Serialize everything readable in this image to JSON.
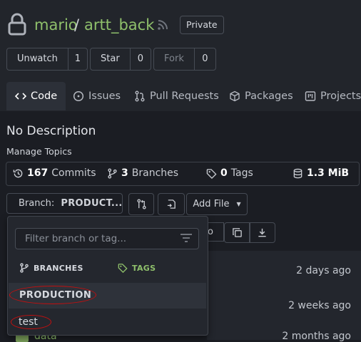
{
  "repo": {
    "owner": "mario",
    "separator": "/",
    "name": "artt_back",
    "visibility": "Private"
  },
  "actions": [
    {
      "label": "Unwatch",
      "count": "1"
    },
    {
      "label": "Star",
      "count": "0"
    },
    {
      "label": "Fork",
      "count": "0"
    }
  ],
  "tabs": [
    {
      "label": "Code",
      "icon": "code-icon"
    },
    {
      "label": "Issues",
      "icon": "issue-icon"
    },
    {
      "label": "Pull Requests",
      "icon": "pull-request-icon"
    },
    {
      "label": "Packages",
      "icon": "package-icon"
    },
    {
      "label": "Projects",
      "icon": "project-icon"
    }
  ],
  "description": "No Description",
  "manage_topics": "Manage Topics",
  "stats": {
    "commits": {
      "count": "167",
      "label": "Commits"
    },
    "branches": {
      "count": "3",
      "label": "Branches"
    },
    "tags": {
      "count": "0",
      "label": "Tags"
    },
    "size": {
      "value": "1.3 MiB"
    }
  },
  "toolbar": {
    "branch_prefix": "Branch: ",
    "branch_value": "PRODUCT...",
    "add_file": "Add File",
    "partial_text": "co"
  },
  "dropdown": {
    "filter_placeholder": "Filter branch or tag...",
    "branches_tab": "BRANCHES",
    "tags_tab": "TAGS",
    "items": [
      "PRODUCTION",
      "test"
    ]
  },
  "files": [
    {
      "name": "",
      "time": "2 days ago"
    },
    {
      "name": "",
      "time": "2 weeks ago"
    },
    {
      "name": "data",
      "time": "2 months ago"
    }
  ],
  "colors": {
    "accent": "#8fc06b",
    "annotation": "#c40f0f"
  }
}
